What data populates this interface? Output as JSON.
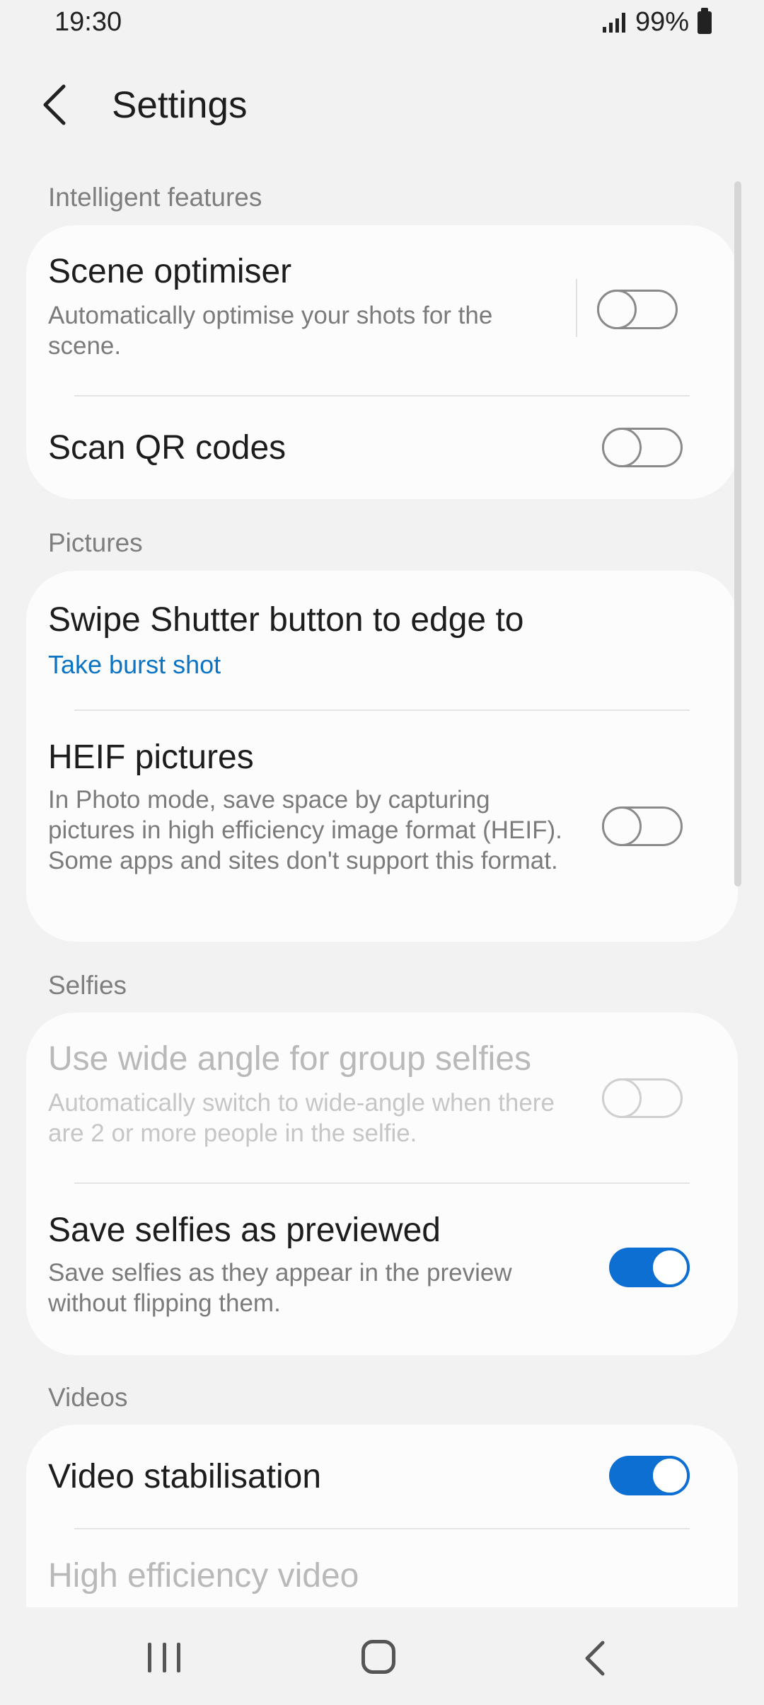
{
  "status_bar": {
    "time": "19:30",
    "battery": "99%"
  },
  "header": {
    "title": "Settings"
  },
  "sections": {
    "intelligent": {
      "title": "Intelligent features",
      "scene_optimiser": {
        "title": "Scene optimiser",
        "subtitle": "Automatically optimise your shots for the scene.",
        "enabled": false
      },
      "scan_qr": {
        "title": "Scan QR codes",
        "enabled": false
      }
    },
    "pictures": {
      "title": "Pictures",
      "swipe_shutter": {
        "title": "Swipe Shutter button to edge to",
        "value": "Take burst shot"
      },
      "heif": {
        "title": "HEIF pictures",
        "subtitle": "In Photo mode, save space by capturing pictures in high efficiency image format (HEIF). Some apps and sites don't support this format.",
        "enabled": false
      }
    },
    "selfies": {
      "title": "Selfies",
      "wide_angle": {
        "title": "Use wide angle for group selfies",
        "subtitle": "Automatically switch to wide-angle when there are 2 or more people in the selfie.",
        "enabled": false,
        "disabled": true
      },
      "save_as_previewed": {
        "title": "Save selfies as previewed",
        "subtitle": "Save selfies as they appear in the preview without flipping them.",
        "enabled": true
      }
    },
    "videos": {
      "title": "Videos",
      "stabilisation": {
        "title": "Video stabilisation",
        "enabled": true
      },
      "high_efficiency": {
        "title": "High efficiency video"
      }
    }
  },
  "icons": {
    "back": "chevron-left-icon",
    "signal": "signal-icon",
    "battery": "battery-icon",
    "nav_recent": "recent-apps-icon",
    "nav_home": "home-icon",
    "nav_back": "back-icon"
  },
  "colors": {
    "accent": "#0e6fd3",
    "link": "#0b74c4",
    "background": "#f2f2f2",
    "card": "#fcfcfc"
  }
}
